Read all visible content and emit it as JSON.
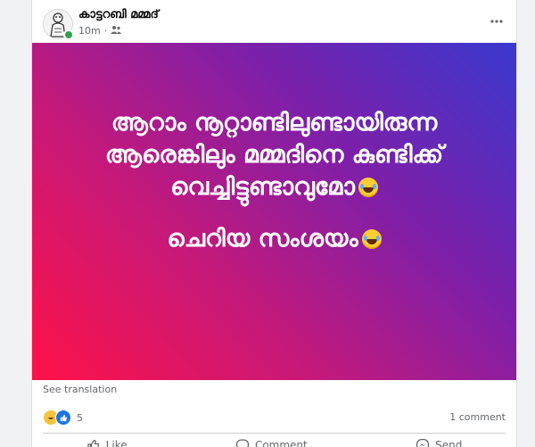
{
  "post": {
    "author": "കാട്ടറബി മമ്മദ്",
    "time": "10m",
    "privacy_icon": "friends-icon",
    "menu_icon": "more-icon",
    "text_line1": "ആറാം നൂറ്റാണ്ടിലുണ്ടായിരുന്ന",
    "text_line2": "ആരെങ്കിലും മമ്മദിനെ കുണ്ടിക്ക്",
    "text_line3": "വെച്ചിട്ടുണ്ടാവുമോ",
    "text_line4": "ചെറിയ സംശയം",
    "emoji": "laughing-tears-emoji",
    "background_colors": [
      "#ff1147",
      "#c5197a",
      "#7f1fa8",
      "#3a38cf"
    ],
    "see_translation": "See translation"
  },
  "stats": {
    "reaction_count": "5",
    "reaction_icons": [
      "haha-icon",
      "like-icon"
    ],
    "comments": "1 comment"
  },
  "actions": {
    "like": "Like",
    "comment": "Comment",
    "send": "Send"
  },
  "colors": {
    "online": "#31a24c",
    "secondary_text": "#65676b",
    "like_blue": "#1b74e4"
  }
}
